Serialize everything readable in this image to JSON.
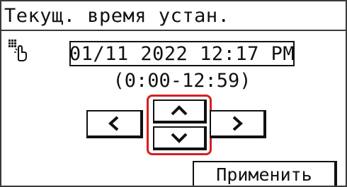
{
  "header": {
    "title": "Текущ. время устан."
  },
  "datetime": {
    "value": "01/11 2022 12:17 PM",
    "range_hint": "(0:00-12:59)"
  },
  "icons": {
    "keypad": "numeric-keypad-touch-icon",
    "left": "chevron-left-icon",
    "right": "chevron-right-icon",
    "up": "chevron-up-icon",
    "down": "chevron-down-icon"
  },
  "colors": {
    "highlight": "#d61f1f",
    "border": "#111111",
    "background": "#ffffff"
  },
  "actions": {
    "apply_label": "Применить"
  }
}
